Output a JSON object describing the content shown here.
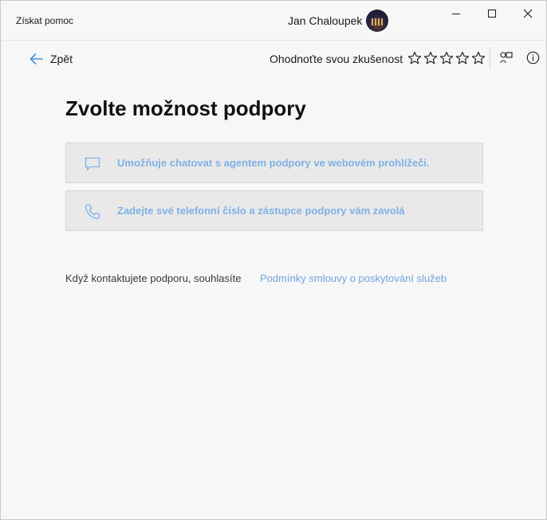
{
  "window": {
    "app_title": "Získat pomoc",
    "user_name": "Jan Chaloupek",
    "controls": {
      "minimize": "minimize-icon",
      "maximize": "maximize-icon",
      "close": "close-icon"
    }
  },
  "commandbar": {
    "back_label": "Zpět",
    "rate_label": "Ohodnoťte svou zkušenost",
    "stars_total": 5,
    "stars_selected": 0,
    "icons": [
      "share-icon",
      "info-icon"
    ]
  },
  "main": {
    "heading": "Zvolte možnost podpory",
    "options": [
      {
        "icon": "chat-icon",
        "label": "Umožňuje chatovat s agentem podpory ve webovém prohlížeči."
      },
      {
        "icon": "phone-icon",
        "label": "Zadejte své telefonní číslo a zástupce podpory vám zavolá"
      }
    ],
    "terms_text": "Když kontaktujete podporu, souhlasíte",
    "terms_link": "Podmínky smlouvy o poskytování služeb"
  },
  "colors": {
    "accent": "#6ea5dd",
    "option_text": "#7fb1e6",
    "option_bg": "#e9e9e9",
    "window_bg": "#f7f7f7"
  }
}
